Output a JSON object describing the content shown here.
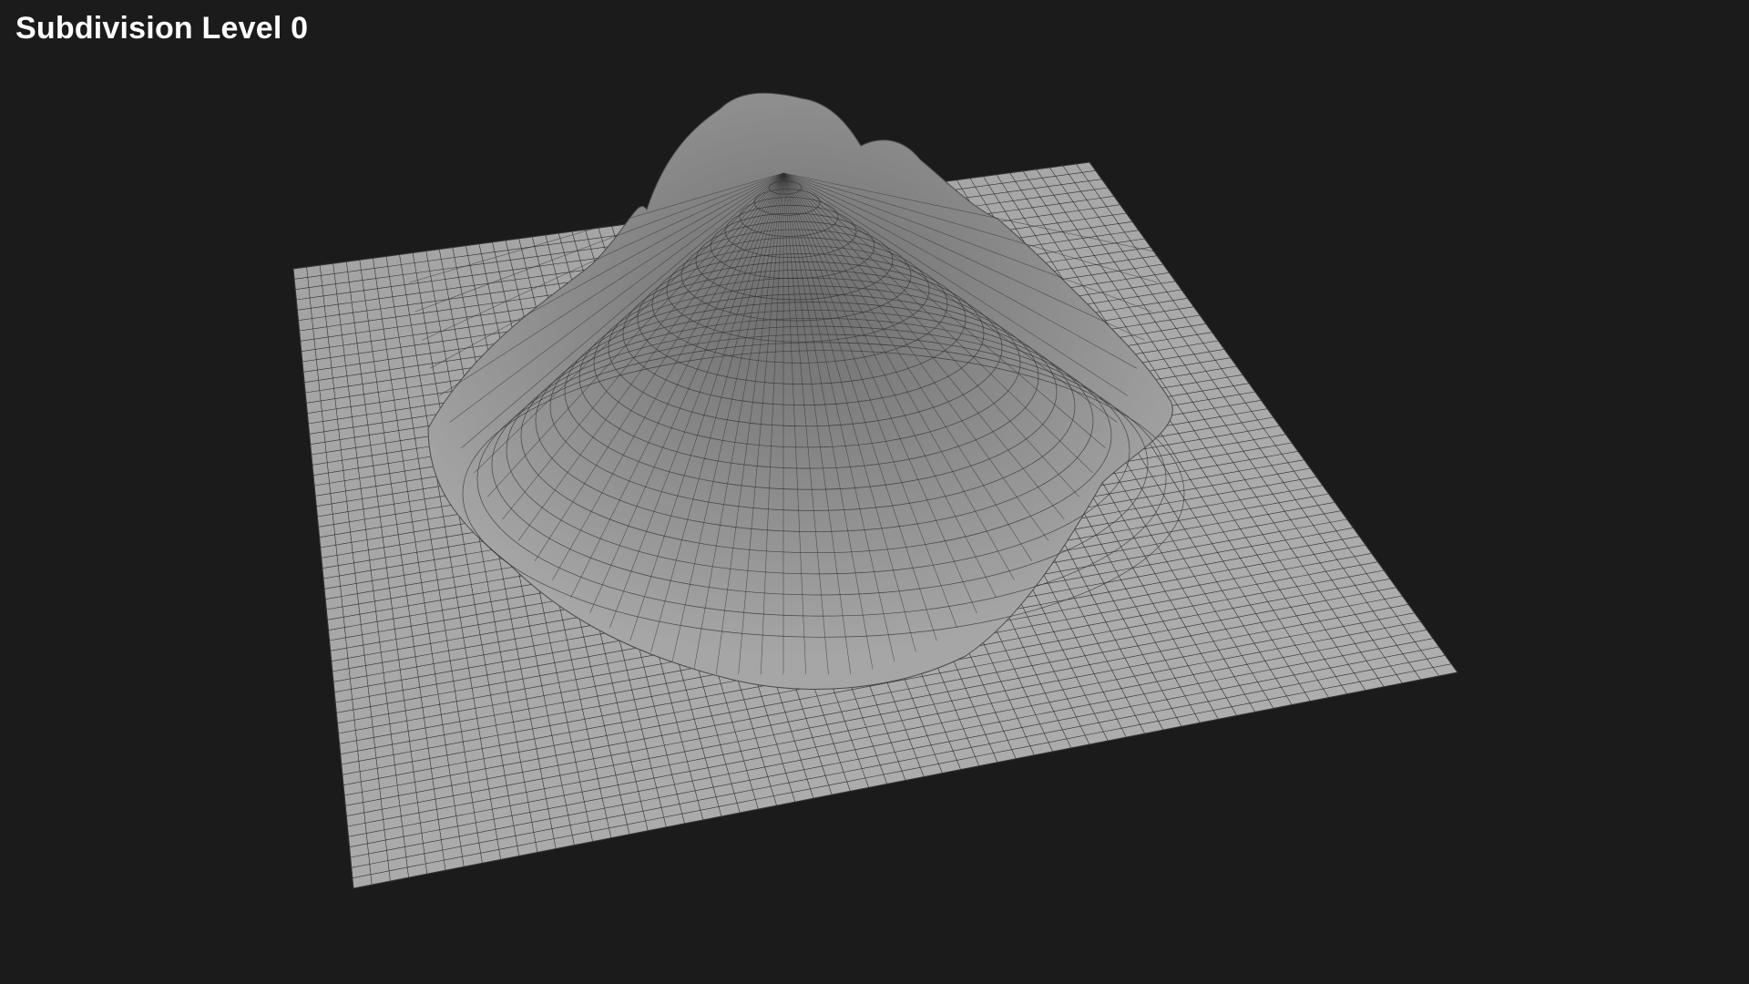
{
  "viewport": {
    "label": "Subdivision Level 0",
    "background_color": "#1b1b1b",
    "label_color": "#ffffff"
  },
  "mesh": {
    "surface_color": "#a8a8a8",
    "wire_color": "#2e2e2e",
    "display": "wireframe-on-shaded"
  }
}
